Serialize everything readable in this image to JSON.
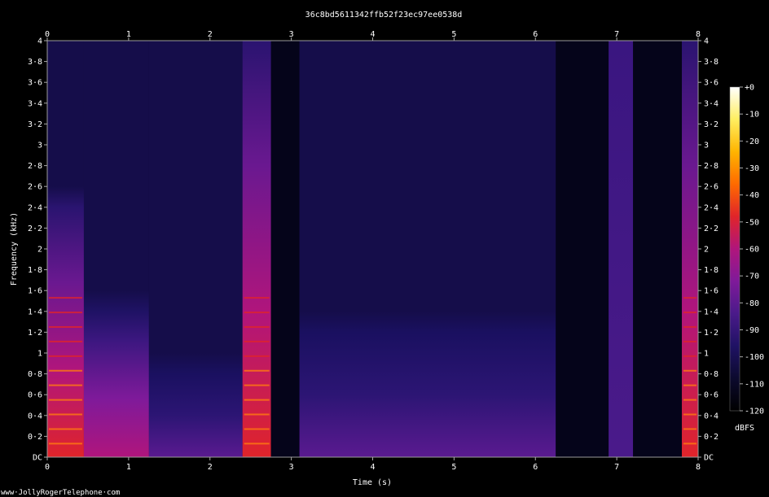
{
  "chart_data": {
    "type": "heatmap",
    "title": "36c8bd5611342ffb52f23ec97ee0538d",
    "xlabel": "Time (s)",
    "ylabel": "Frequency (kHz)",
    "xlim": [
      0,
      8
    ],
    "ylim": [
      0,
      4
    ],
    "x_ticks": [
      "0",
      "1",
      "2",
      "3",
      "4",
      "5",
      "6",
      "7",
      "8"
    ],
    "y_ticks": [
      "DC",
      "0·2",
      "0·4",
      "0·6",
      "0·8",
      "1",
      "1·2",
      "1·4",
      "1·6",
      "1·8",
      "2",
      "2·2",
      "2·4",
      "2·6",
      "2·8",
      "3",
      "3·2",
      "3·4",
      "3·6",
      "3·8",
      "4"
    ],
    "colorbar": {
      "label": "dBFS",
      "range": [
        -120,
        0
      ],
      "ticks": [
        "+0",
        "-10",
        "-20",
        "-30",
        "-40",
        "-50",
        "-60",
        "-70",
        "-80",
        "-90",
        "-100",
        "-110",
        "-120"
      ]
    },
    "segments": [
      {
        "t0": 0.0,
        "t1": 0.45,
        "level": "loud",
        "fmax": 2.4
      },
      {
        "t0": 0.45,
        "t1": 1.25,
        "level": "mid",
        "fmax": 1.4
      },
      {
        "t0": 1.25,
        "t1": 2.4,
        "level": "quiet",
        "fmax": 0.8
      },
      {
        "t0": 2.4,
        "t1": 2.75,
        "level": "loud",
        "fmax": 4.0
      },
      {
        "t0": 2.75,
        "t1": 3.1,
        "level": "silent",
        "fmax": 0
      },
      {
        "t0": 3.1,
        "t1": 6.25,
        "level": "quiet",
        "fmax": 1.2
      },
      {
        "t0": 6.25,
        "t1": 6.9,
        "level": "silent",
        "fmax": 0
      },
      {
        "t0": 6.9,
        "t1": 7.2,
        "level": "faint",
        "fmax": 4.0
      },
      {
        "t0": 7.2,
        "t1": 7.8,
        "level": "silent",
        "fmax": 0
      },
      {
        "t0": 7.8,
        "t1": 8.0,
        "level": "loud",
        "fmax": 4.0
      }
    ],
    "colors": {
      "background": "#000000",
      "colormap": [
        "#000000",
        "#0c0a2e",
        "#1f1264",
        "#4a1a8a",
        "#7f1a9a",
        "#b0157c",
        "#e0242a",
        "#ff6a00",
        "#ffb400",
        "#ffee60",
        "#ffffff"
      ]
    }
  },
  "footer": {
    "credit": "www·JollyRogerTelephone·com"
  }
}
